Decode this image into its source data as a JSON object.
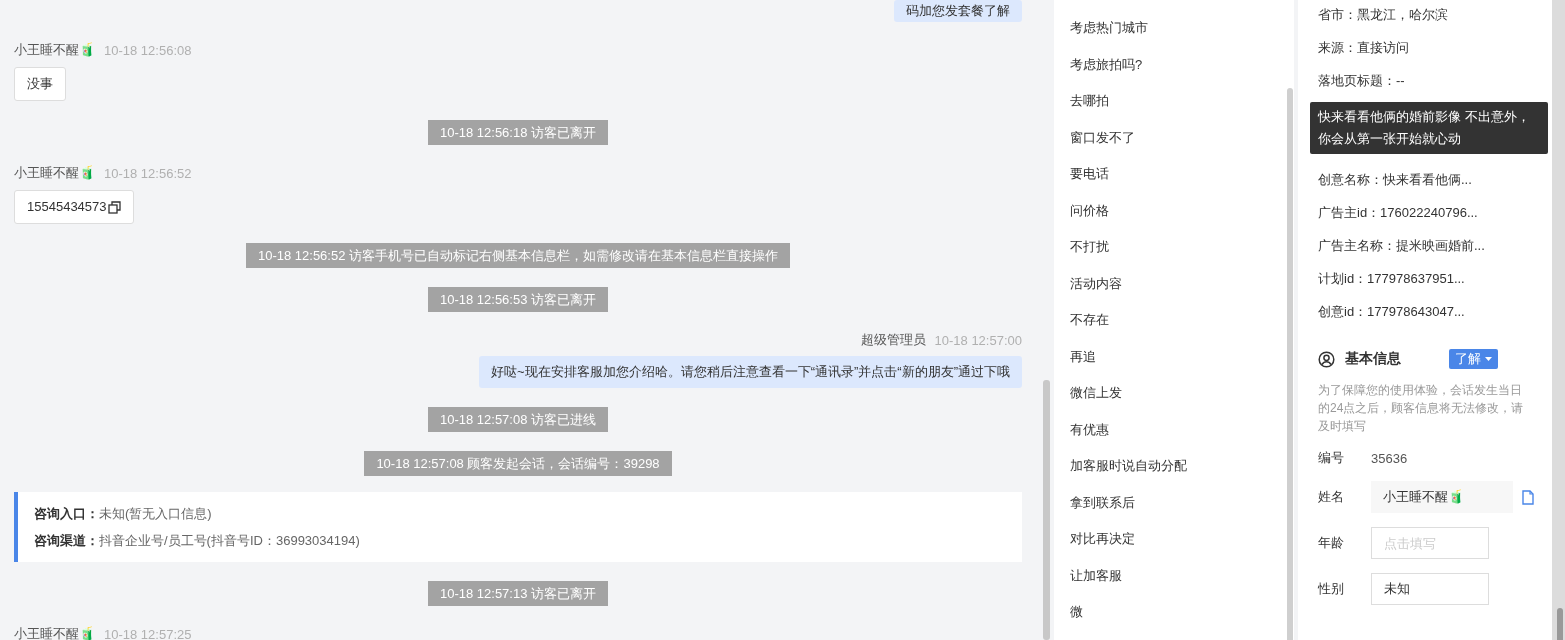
{
  "messages": [
    {
      "kind": "outgoing",
      "text": "码加您发套餐了解"
    },
    {
      "kind": "incoming",
      "sender": "小王睡不醒🧃",
      "time": "10-18 12:56:08",
      "text": "没事"
    },
    {
      "kind": "system",
      "text": "10-18 12:56:18 访客已离开"
    },
    {
      "kind": "incoming",
      "sender": "小王睡不醒🧃",
      "time": "10-18 12:56:52",
      "text": "15545434573",
      "copy": true
    },
    {
      "kind": "system",
      "text": "10-18 12:56:52 访客手机号已自动标记右侧基本信息栏，如需修改请在基本信息栏直接操作"
    },
    {
      "kind": "system",
      "text": "10-18 12:56:53 访客已离开"
    },
    {
      "kind": "outgoing",
      "sender": "超级管理员",
      "time": "10-18 12:57:00",
      "text": "好哒~现在安排客服加您介绍哈。请您稍后注意查看一下“通讯录”并点击“新的朋友”通过下哦"
    },
    {
      "kind": "system",
      "text": "10-18 12:57:08 访客已进线"
    },
    {
      "kind": "system",
      "text": "10-18 12:57:08 顾客发起会话，会话编号：39298"
    },
    {
      "kind": "entry",
      "lines": [
        {
          "label": "咨询入口：",
          "value": "未知(暂无入口信息)"
        },
        {
          "label": "咨询渠道：",
          "value": "抖音企业号/员工号(抖音号ID：36993034194)"
        }
      ]
    },
    {
      "kind": "system",
      "text": "10-18 12:57:13 访客已离开"
    },
    {
      "kind": "incoming",
      "sender": "小王睡不醒🧃",
      "time": "10-18 12:57:25"
    }
  ],
  "quick_replies": [
    "考虑热门城市",
    "考虑旅拍吗?",
    "去哪拍",
    "窗口发不了",
    "要电话",
    "问价格",
    "不打扰",
    "活动内容",
    "不存在",
    "再追",
    "微信上发",
    "有优惠",
    "加客服时说自动分配",
    "拿到联系后",
    "对比再决定",
    "让加客服",
    "微"
  ],
  "visitor_info": [
    {
      "kind": "row",
      "text": "省市：黑龙江，哈尔滨"
    },
    {
      "kind": "row",
      "text": "来源：直接访问"
    },
    {
      "kind": "row",
      "text": "落地页标题：--"
    },
    {
      "kind": "tooltip",
      "text": "快来看看他俩的婚前影像 不出意外，你会从第一张开始就心动"
    },
    {
      "kind": "row",
      "text": "创意名称：快来看看他俩..."
    },
    {
      "kind": "row",
      "text": "广告主id：176022240796..."
    },
    {
      "kind": "row",
      "text": "广告主名称：提米映画婚前..."
    },
    {
      "kind": "row",
      "text": "计划id：177978637951..."
    },
    {
      "kind": "row",
      "text": "创意id：177978643047..."
    }
  ],
  "basic_info": {
    "title": "基本信息",
    "button": "了解",
    "notice": "为了保障您的使用体验，会话发生当日的24点之后，顾客信息将无法修改，请及时填写",
    "fields": [
      {
        "kind": "text",
        "label": "编号",
        "value": "35636"
      },
      {
        "kind": "readonly",
        "label": "姓名",
        "value": "小王睡不醒🧃",
        "copy": true
      },
      {
        "kind": "input",
        "label": "年龄",
        "placeholder": "点击填写"
      },
      {
        "kind": "input",
        "label": "性别",
        "value": "未知"
      }
    ]
  }
}
